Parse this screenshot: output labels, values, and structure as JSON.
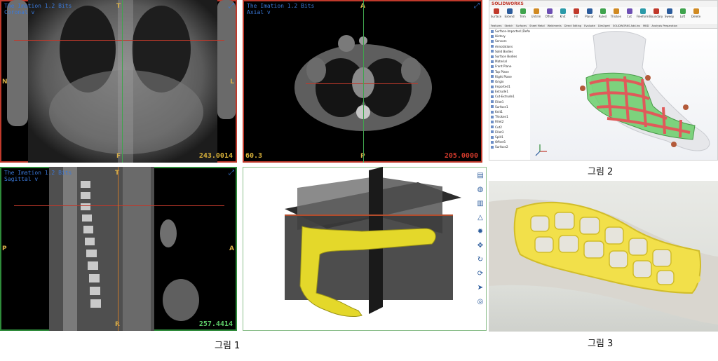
{
  "figure1": {
    "caption": "그림 1",
    "coronal": {
      "title_line1": "The Imation 1.2 Bits",
      "title_line2": "Coronal v",
      "top_mark": "T",
      "left_mark": "N",
      "right_mark": "L",
      "bottom_mark": "F",
      "value": "243.0014",
      "value_color": "#d8b13a"
    },
    "axial": {
      "title_line1": "The Imation 1.2 Bits",
      "title_line2": "Axial v",
      "top_mark": "A",
      "bottom_mark": "P",
      "left_value": "60.3",
      "value": "205.0000",
      "value_color": "#d33a2c"
    },
    "sagittal": {
      "title_line1": "The Imation 1.2 Bits",
      "title_line2": "Sagittal v",
      "top_mark": "T",
      "left_mark": "P",
      "right_mark": "A",
      "bottom_mark": "R",
      "value": "257.4414",
      "value_color": "#5fcf6a"
    },
    "volume_toolbar_icons": [
      "layers-icon",
      "globe-icon",
      "slice-icon",
      "cone-icon",
      "settings-icon",
      "move-icon",
      "rotate-icon",
      "refresh-icon",
      "cursor-icon",
      "target-icon"
    ]
  },
  "figure2": {
    "caption": "그림 2",
    "app_title": "SOLIDWORKS",
    "ribbon": [
      "Surface",
      "Extend",
      "Trim",
      "Untrim",
      "Offset",
      "Knit",
      "Fill",
      "Planar",
      "Ruled",
      "Thicken",
      "Cut",
      "Freeform",
      "Boundary",
      "Sweep",
      "Loft",
      "Delete"
    ],
    "tabs": [
      "Features",
      "Sketch",
      "Surfaces",
      "Sheet Metal",
      "Weldments",
      "Direct Editing",
      "Evaluate",
      "DimXpert",
      "SOLIDWORKS Add-Ins",
      "MBD",
      "Analysis Preparation"
    ],
    "tree": [
      "Surface-Imported (Default)",
      "History",
      "Sensors",
      "Annotations",
      "Solid Bodies",
      "Surface Bodies",
      "Material",
      "Front Plane",
      "Top Plane",
      "Right Plane",
      "Origin",
      "Imported1",
      "Extrude1",
      "Cut-Extrude1",
      "Fillet1",
      "Surface1",
      "Knit1",
      "Thicken1",
      "Fillet2",
      "Cut2",
      "Fillet3",
      "Split1",
      "Offset1",
      "Surface2"
    ],
    "accent": "#c0392b"
  },
  "figure3": {
    "caption": "그림 3",
    "cast_color": "#f2e04a"
  }
}
